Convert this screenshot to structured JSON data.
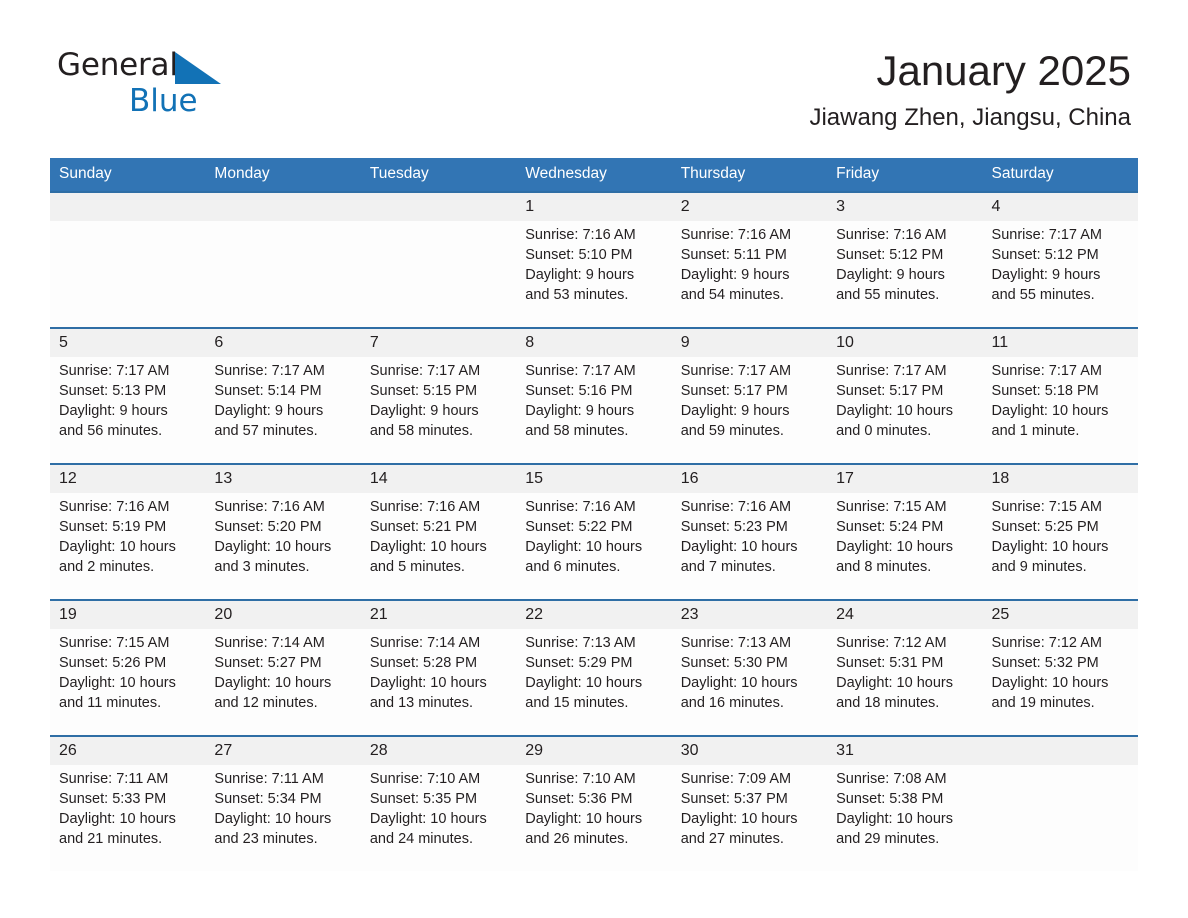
{
  "brand": {
    "name_part1": "General",
    "name_part2": "Blue",
    "triangle_color": "#1272b6"
  },
  "header": {
    "title": "January 2025",
    "subtitle": "Jiawang Zhen, Jiangsu, China"
  },
  "theme": {
    "header_bg": "#3275b4",
    "row_divider": "#2f6ea5",
    "daynum_bg": "#f1f1f1",
    "cell_bg": "#fdfdfd",
    "text": "#231f20"
  },
  "weekday_headers": [
    "Sunday",
    "Monday",
    "Tuesday",
    "Wednesday",
    "Thursday",
    "Friday",
    "Saturday"
  ],
  "weeks": [
    [
      {
        "day": "",
        "lines": []
      },
      {
        "day": "",
        "lines": []
      },
      {
        "day": "",
        "lines": []
      },
      {
        "day": "1",
        "lines": [
          "Sunrise: 7:16 AM",
          "Sunset: 5:10 PM",
          "Daylight: 9 hours",
          "and 53 minutes."
        ]
      },
      {
        "day": "2",
        "lines": [
          "Sunrise: 7:16 AM",
          "Sunset: 5:11 PM",
          "Daylight: 9 hours",
          "and 54 minutes."
        ]
      },
      {
        "day": "3",
        "lines": [
          "Sunrise: 7:16 AM",
          "Sunset: 5:12 PM",
          "Daylight: 9 hours",
          "and 55 minutes."
        ]
      },
      {
        "day": "4",
        "lines": [
          "Sunrise: 7:17 AM",
          "Sunset: 5:12 PM",
          "Daylight: 9 hours",
          "and 55 minutes."
        ]
      }
    ],
    [
      {
        "day": "5",
        "lines": [
          "Sunrise: 7:17 AM",
          "Sunset: 5:13 PM",
          "Daylight: 9 hours",
          "and 56 minutes."
        ]
      },
      {
        "day": "6",
        "lines": [
          "Sunrise: 7:17 AM",
          "Sunset: 5:14 PM",
          "Daylight: 9 hours",
          "and 57 minutes."
        ]
      },
      {
        "day": "7",
        "lines": [
          "Sunrise: 7:17 AM",
          "Sunset: 5:15 PM",
          "Daylight: 9 hours",
          "and 58 minutes."
        ]
      },
      {
        "day": "8",
        "lines": [
          "Sunrise: 7:17 AM",
          "Sunset: 5:16 PM",
          "Daylight: 9 hours",
          "and 58 minutes."
        ]
      },
      {
        "day": "9",
        "lines": [
          "Sunrise: 7:17 AM",
          "Sunset: 5:17 PM",
          "Daylight: 9 hours",
          "and 59 minutes."
        ]
      },
      {
        "day": "10",
        "lines": [
          "Sunrise: 7:17 AM",
          "Sunset: 5:17 PM",
          "Daylight: 10 hours",
          "and 0 minutes."
        ]
      },
      {
        "day": "11",
        "lines": [
          "Sunrise: 7:17 AM",
          "Sunset: 5:18 PM",
          "Daylight: 10 hours",
          "and 1 minute."
        ]
      }
    ],
    [
      {
        "day": "12",
        "lines": [
          "Sunrise: 7:16 AM",
          "Sunset: 5:19 PM",
          "Daylight: 10 hours",
          "and 2 minutes."
        ]
      },
      {
        "day": "13",
        "lines": [
          "Sunrise: 7:16 AM",
          "Sunset: 5:20 PM",
          "Daylight: 10 hours",
          "and 3 minutes."
        ]
      },
      {
        "day": "14",
        "lines": [
          "Sunrise: 7:16 AM",
          "Sunset: 5:21 PM",
          "Daylight: 10 hours",
          "and 5 minutes."
        ]
      },
      {
        "day": "15",
        "lines": [
          "Sunrise: 7:16 AM",
          "Sunset: 5:22 PM",
          "Daylight: 10 hours",
          "and 6 minutes."
        ]
      },
      {
        "day": "16",
        "lines": [
          "Sunrise: 7:16 AM",
          "Sunset: 5:23 PM",
          "Daylight: 10 hours",
          "and 7 minutes."
        ]
      },
      {
        "day": "17",
        "lines": [
          "Sunrise: 7:15 AM",
          "Sunset: 5:24 PM",
          "Daylight: 10 hours",
          "and 8 minutes."
        ]
      },
      {
        "day": "18",
        "lines": [
          "Sunrise: 7:15 AM",
          "Sunset: 5:25 PM",
          "Daylight: 10 hours",
          "and 9 minutes."
        ]
      }
    ],
    [
      {
        "day": "19",
        "lines": [
          "Sunrise: 7:15 AM",
          "Sunset: 5:26 PM",
          "Daylight: 10 hours",
          "and 11 minutes."
        ]
      },
      {
        "day": "20",
        "lines": [
          "Sunrise: 7:14 AM",
          "Sunset: 5:27 PM",
          "Daylight: 10 hours",
          "and 12 minutes."
        ]
      },
      {
        "day": "21",
        "lines": [
          "Sunrise: 7:14 AM",
          "Sunset: 5:28 PM",
          "Daylight: 10 hours",
          "and 13 minutes."
        ]
      },
      {
        "day": "22",
        "lines": [
          "Sunrise: 7:13 AM",
          "Sunset: 5:29 PM",
          "Daylight: 10 hours",
          "and 15 minutes."
        ]
      },
      {
        "day": "23",
        "lines": [
          "Sunrise: 7:13 AM",
          "Sunset: 5:30 PM",
          "Daylight: 10 hours",
          "and 16 minutes."
        ]
      },
      {
        "day": "24",
        "lines": [
          "Sunrise: 7:12 AM",
          "Sunset: 5:31 PM",
          "Daylight: 10 hours",
          "and 18 minutes."
        ]
      },
      {
        "day": "25",
        "lines": [
          "Sunrise: 7:12 AM",
          "Sunset: 5:32 PM",
          "Daylight: 10 hours",
          "and 19 minutes."
        ]
      }
    ],
    [
      {
        "day": "26",
        "lines": [
          "Sunrise: 7:11 AM",
          "Sunset: 5:33 PM",
          "Daylight: 10 hours",
          "and 21 minutes."
        ]
      },
      {
        "day": "27",
        "lines": [
          "Sunrise: 7:11 AM",
          "Sunset: 5:34 PM",
          "Daylight: 10 hours",
          "and 23 minutes."
        ]
      },
      {
        "day": "28",
        "lines": [
          "Sunrise: 7:10 AM",
          "Sunset: 5:35 PM",
          "Daylight: 10 hours",
          "and 24 minutes."
        ]
      },
      {
        "day": "29",
        "lines": [
          "Sunrise: 7:10 AM",
          "Sunset: 5:36 PM",
          "Daylight: 10 hours",
          "and 26 minutes."
        ]
      },
      {
        "day": "30",
        "lines": [
          "Sunrise: 7:09 AM",
          "Sunset: 5:37 PM",
          "Daylight: 10 hours",
          "and 27 minutes."
        ]
      },
      {
        "day": "31",
        "lines": [
          "Sunrise: 7:08 AM",
          "Sunset: 5:38 PM",
          "Daylight: 10 hours",
          "and 29 minutes."
        ]
      },
      {
        "day": "",
        "lines": []
      }
    ]
  ]
}
